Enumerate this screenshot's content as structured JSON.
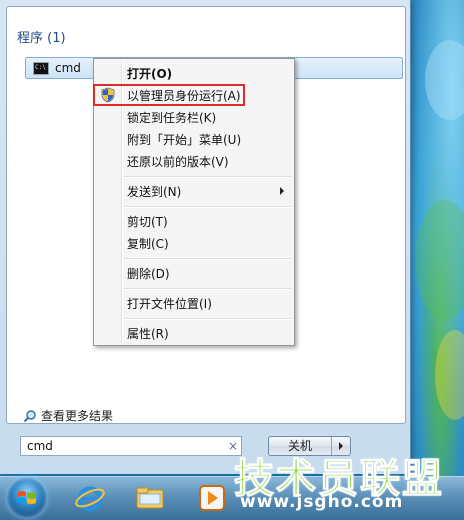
{
  "start_menu": {
    "section_title": "程序 (1)",
    "result": {
      "label": "cmd",
      "icon": "cmd-icon"
    },
    "see_more": "查看更多结果",
    "search": {
      "value": "cmd",
      "clear_symbol": "×"
    },
    "shutdown": {
      "label": "关机"
    }
  },
  "context_menu": {
    "items": [
      {
        "label": "打开(O)",
        "bold": true
      },
      {
        "label": "以管理员身份运行(A)",
        "icon": "uac-shield-icon",
        "highlighted": true
      },
      {
        "label": "锁定到任务栏(K)"
      },
      {
        "label": "附到「开始」菜单(U)"
      },
      {
        "label": "还原以前的版本(V)"
      },
      {
        "label": "发送到(N)",
        "submenu": true
      },
      {
        "label": "剪切(T)"
      },
      {
        "label": "复制(C)"
      },
      {
        "label": "删除(D)"
      },
      {
        "label": "打开文件位置(I)"
      },
      {
        "label": "属性(R)"
      }
    ],
    "highlight_color": "#e12a2a"
  },
  "taskbar": {
    "icons": [
      "windows-start-orb-icon",
      "internet-explorer-icon",
      "windows-explorer-icon",
      "media-player-icon"
    ]
  },
  "watermark": {
    "title": "技术员联盟",
    "url": "www.jsgho.com"
  },
  "colors": {
    "accent": "#1e4b82",
    "selection": "#cfe3f7",
    "watermark_green": "#7fcf2a"
  }
}
